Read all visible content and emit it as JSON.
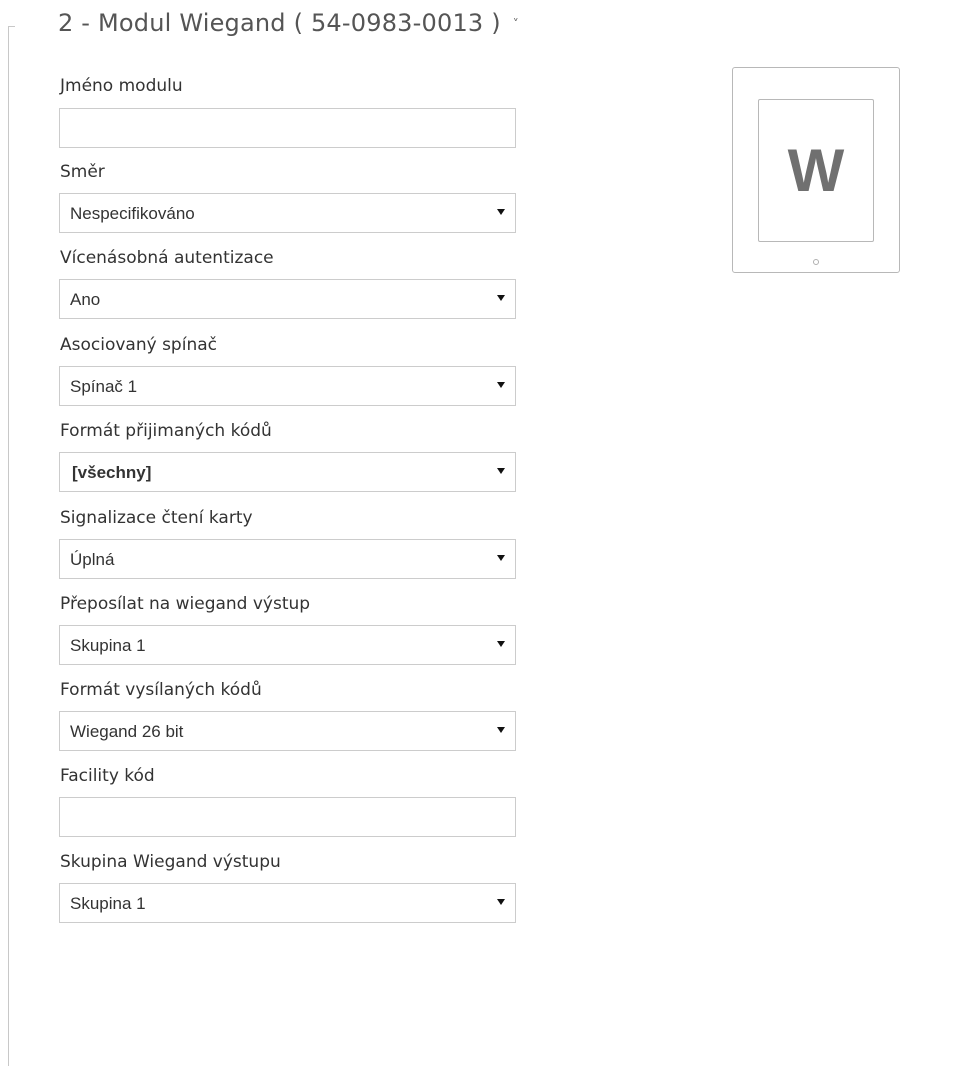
{
  "section": {
    "title": "2 - Modul Wiegand ( 54-0983-0013 )",
    "chevron": "˅"
  },
  "fields": {
    "module_name": {
      "label": "Jméno modulu",
      "value": ""
    },
    "direction": {
      "label": "Směr",
      "value": "Nespecifikováno"
    },
    "multi_auth": {
      "label": "Vícenásobná autentizace",
      "value": "Ano"
    },
    "associated_switch": {
      "label": "Asociovaný spínač",
      "value": "Spínač 1"
    },
    "received_code_format": {
      "label": "Formát přijimaných kódů",
      "value": "[všechny]"
    },
    "card_read_signal": {
      "label": "Signalizace čtení karty",
      "value": "Úplná"
    },
    "forward_to_output": {
      "label": "Přeposílat na wiegand výstup",
      "value": "Skupina 1"
    },
    "sent_code_format": {
      "label": "Formát vysílaných kódů",
      "value": "Wiegand 26 bit"
    },
    "facility_code": {
      "label": "Facility kód",
      "value": ""
    },
    "output_group": {
      "label": "Skupina Wiegand výstupu",
      "value": "Skupina 1"
    }
  },
  "module_image": {
    "letter": "W",
    "icon": "wiegand-module-icon"
  }
}
